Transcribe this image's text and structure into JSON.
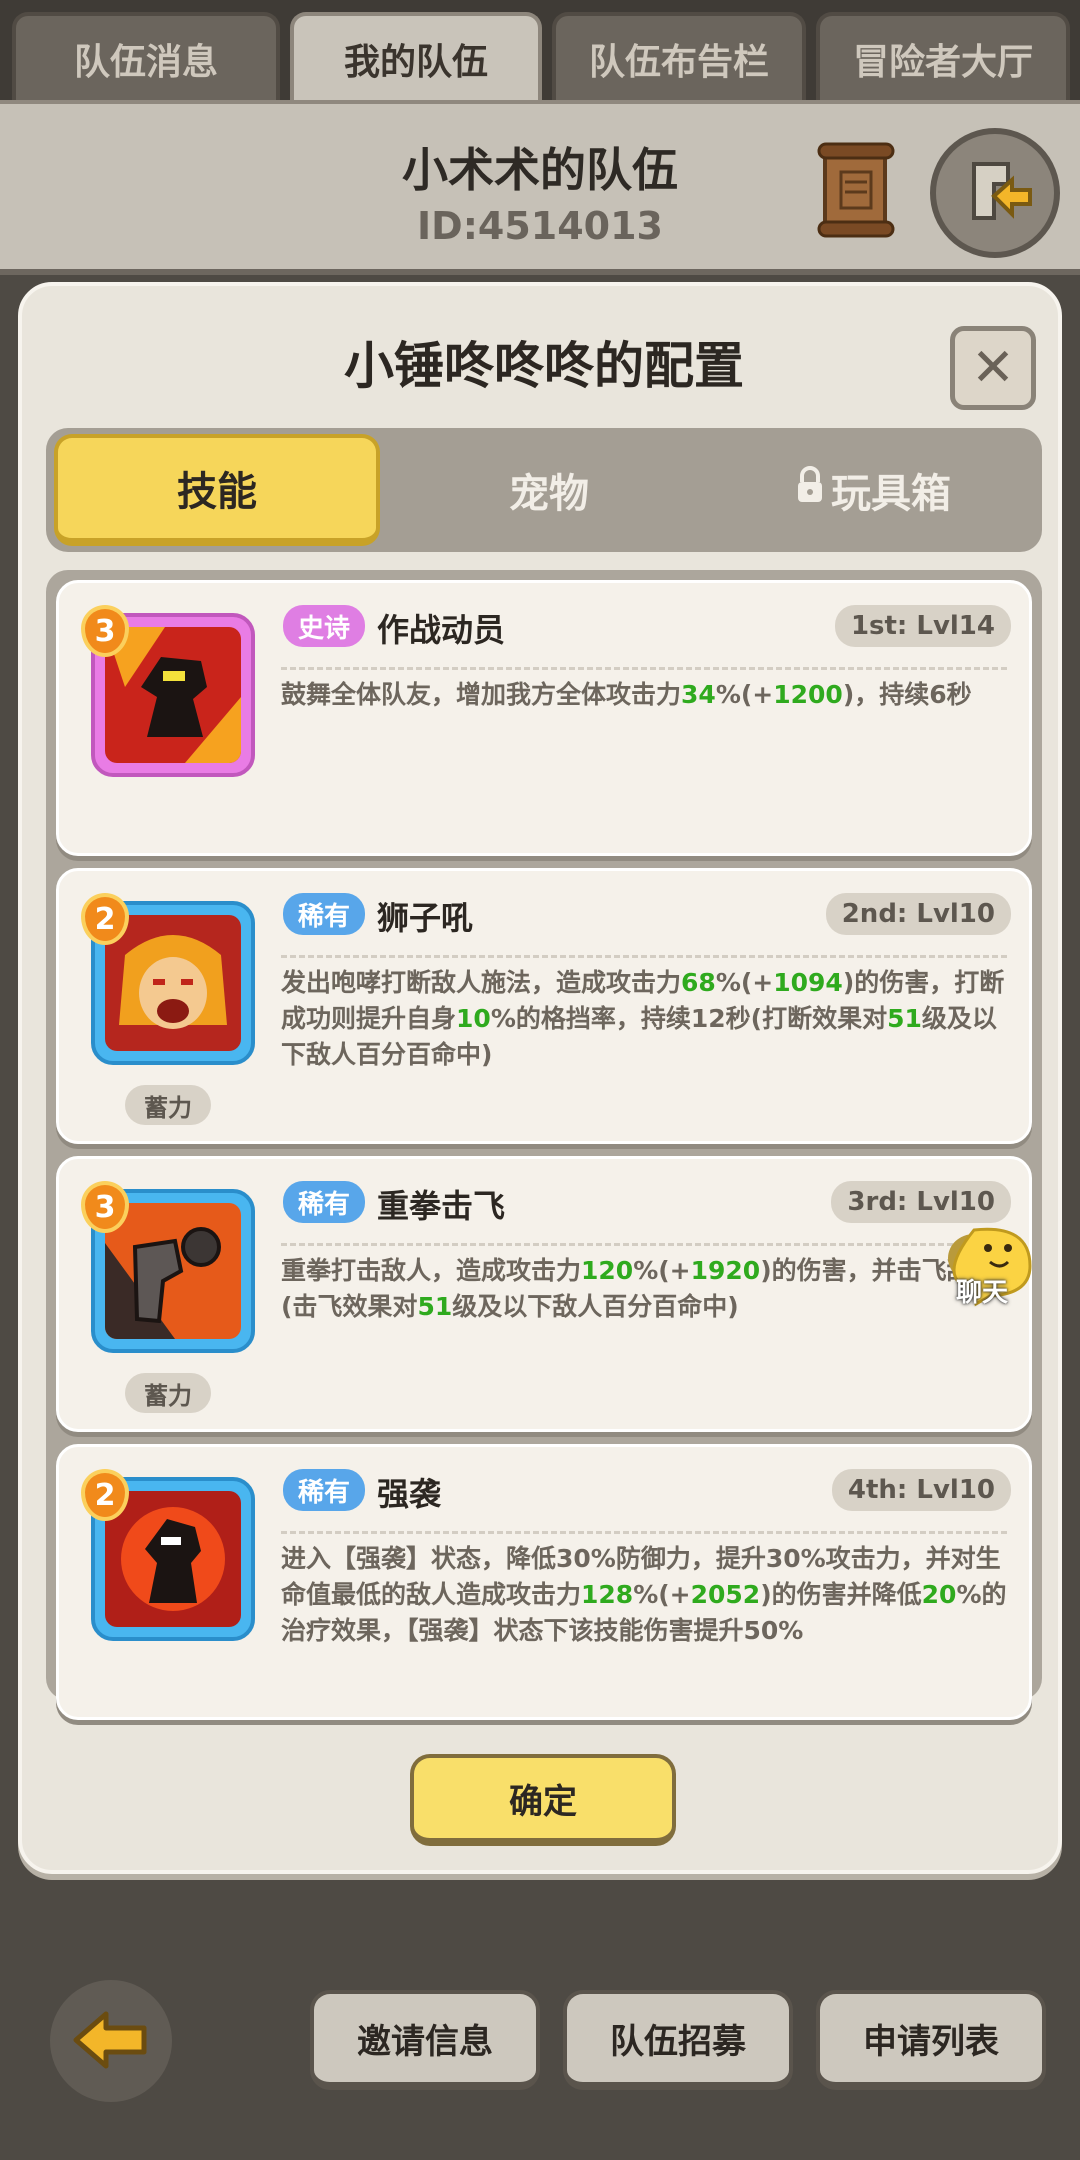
{
  "tabs": [
    {
      "label": "队伍消息"
    },
    {
      "label": "我的队伍"
    },
    {
      "label": "队伍布告栏"
    },
    {
      "label": "冒险者大厅"
    }
  ],
  "header": {
    "team_name": "小术术的队伍",
    "team_id": "ID:4514013"
  },
  "modal": {
    "title": "小锤咚咚咚的配置",
    "close_label": "✕",
    "segments": [
      {
        "label": "技能"
      },
      {
        "label": "宠物"
      },
      {
        "label": "玩具箱",
        "locked": true
      }
    ],
    "skills": [
      {
        "level": "3",
        "rarity": "史诗",
        "name": "作战动员",
        "slot": "1st: Lvl14",
        "charge": "",
        "desc_parts": [
          {
            "t": "鼓舞全体队友，增加我方全体攻击力",
            "g": false
          },
          {
            "t": "34",
            "g": true
          },
          {
            "t": "%(+",
            "g": false
          },
          {
            "t": "1200",
            "g": true
          },
          {
            "t": ")，持续6秒",
            "g": false
          }
        ]
      },
      {
        "level": "2",
        "rarity": "稀有",
        "name": "狮子吼",
        "slot": "2nd: Lvl10",
        "charge": "蓄力",
        "desc_parts": [
          {
            "t": "发出咆哮打断敌人施法，造成攻击力",
            "g": false
          },
          {
            "t": "68",
            "g": true
          },
          {
            "t": "%(+",
            "g": false
          },
          {
            "t": "1094",
            "g": true
          },
          {
            "t": ")的伤害，打断成功则提升自身",
            "g": false
          },
          {
            "t": "10",
            "g": true
          },
          {
            "t": "%的格挡率，持续12秒(打断效果对",
            "g": false
          },
          {
            "t": "51",
            "g": true
          },
          {
            "t": "级及以下敌人百分百命中)",
            "g": false
          }
        ]
      },
      {
        "level": "3",
        "rarity": "稀有",
        "name": "重拳击飞",
        "slot": "3rd: Lvl10",
        "charge": "蓄力",
        "desc_parts": [
          {
            "t": "重拳打击敌人，造成攻击力",
            "g": false
          },
          {
            "t": "120",
            "g": true
          },
          {
            "t": "%(+",
            "g": false
          },
          {
            "t": "1920",
            "g": true
          },
          {
            "t": ")的伤害，并击飞敌人(击飞效果对",
            "g": false
          },
          {
            "t": "51",
            "g": true
          },
          {
            "t": "级及以下敌人百分百命中)",
            "g": false
          }
        ]
      },
      {
        "level": "2",
        "rarity": "稀有",
        "name": "强袭",
        "slot": "4th: Lvl10",
        "charge": "",
        "desc_parts": [
          {
            "t": "进入【强袭】状态，降低30%防御力，提升30%攻击力，并对生命值最低的敌人造成攻击力",
            "g": false
          },
          {
            "t": "128",
            "g": true
          },
          {
            "t": "%(+",
            "g": false
          },
          {
            "t": "2052",
            "g": true
          },
          {
            "t": ")的伤害并降低",
            "g": false
          },
          {
            "t": "20",
            "g": true
          },
          {
            "t": "%的治疗效果，【强袭】状态下该技能伤害提升50%",
            "g": false
          }
        ]
      }
    ],
    "confirm_label": "确定"
  },
  "chat_label": "聊天",
  "bottom": {
    "buttons": [
      {
        "label": "邀请信息"
      },
      {
        "label": "队伍招募"
      },
      {
        "label": "申请列表"
      }
    ]
  },
  "icons": {
    "scroll": "scroll-icon",
    "exit": "exit-arrow-icon",
    "back": "back-arrow-icon",
    "lock": "lock-icon",
    "chat": "chat-bubble-icon"
  }
}
